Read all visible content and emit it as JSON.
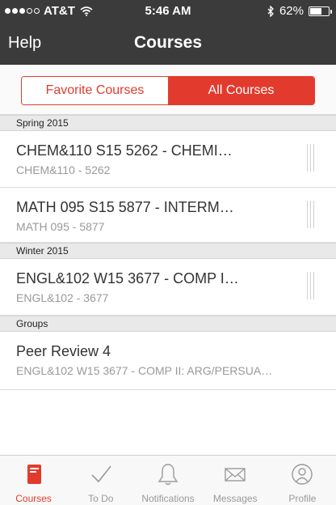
{
  "status_bar": {
    "carrier": "AT&T",
    "time": "5:46 AM",
    "battery": "62%",
    "battery_level": 0.62
  },
  "nav": {
    "left_label": "Help",
    "title": "Courses"
  },
  "segments": {
    "favorites_label": "Favorite Courses",
    "all_label": "All Courses",
    "selected": "All Courses"
  },
  "sections": [
    {
      "header": "Spring 2015",
      "rows": [
        {
          "title": "CHEM&110  S15  5262 - CHEMI…",
          "subtitle": "CHEM&110 - 5262"
        },
        {
          "title": "MATH 095  S15  5877 - INTERM…",
          "subtitle": "MATH 095 - 5877"
        }
      ]
    },
    {
      "header": "Winter 2015",
      "rows": [
        {
          "title": "ENGL&102  W15  3677 - COMP I…",
          "subtitle": "ENGL&102 - 3677"
        }
      ]
    },
    {
      "header": "Groups",
      "rows": [
        {
          "title": "Peer Review 4",
          "subtitle": "ENGL&102  W15  3677 - COMP II: ARG/PERSUA…"
        }
      ]
    }
  ],
  "tabs": [
    {
      "label": "Courses",
      "icon": "book-icon",
      "active": true
    },
    {
      "label": "To Do",
      "icon": "checkmark-icon",
      "active": false
    },
    {
      "label": "Notifications",
      "icon": "bell-icon",
      "active": false
    },
    {
      "label": "Messages",
      "icon": "envelope-icon",
      "active": false
    },
    {
      "label": "Profile",
      "icon": "person-icon",
      "active": false
    }
  ],
  "colors": {
    "accent": "#e23b2d",
    "nav_background": "#3b3b3b",
    "inactive_tab": "#9a9a9a"
  }
}
